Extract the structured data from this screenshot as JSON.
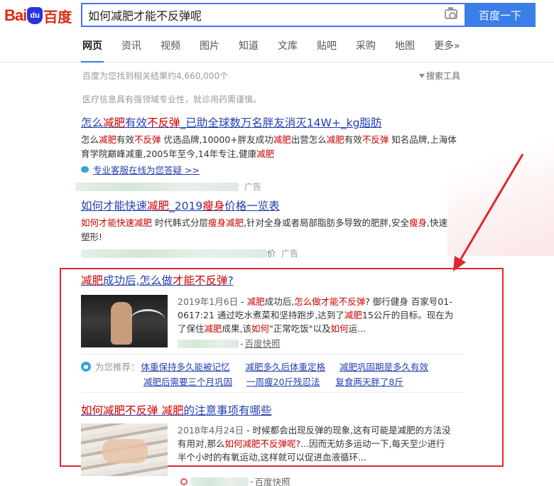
{
  "logo": {
    "en": "Bai",
    "paw": "du",
    "cn": "百度"
  },
  "search": {
    "query": "如何减肥才能不反弹呢",
    "button": "百度一下"
  },
  "nav": [
    "网页",
    "资讯",
    "视频",
    "图片",
    "知道",
    "文库",
    "贴吧",
    "采购",
    "地图",
    "更多»"
  ],
  "results": {
    "count_text": "百度为您找到相关结果约4,660,000个",
    "tools_label": "搜索工具",
    "medical_notice": "医疗信息具有强领域专业性，就诊用药需谨慎。"
  },
  "ad1": {
    "title": [
      "怎么",
      "减肥",
      "有效",
      "不反弹",
      "_已助全球数万名胖友消灭14W+_kg脂肪"
    ],
    "snippet_line1": [
      "怎么",
      "减肥",
      "有效",
      "不反弹",
      " 优选品牌,10000+胖友成功",
      "减肥",
      "出营怎么",
      "减肥",
      "有效",
      "不反弹",
      " 知名品牌,上海体"
    ],
    "snippet_line2": [
      "育学院巅峰减重,2005年至今,14年专注,健康",
      "减肥"
    ],
    "service_link": "专业客服在线为您答疑 >>",
    "ad_tag": "广告"
  },
  "ad2": {
    "title": [
      "如何才能快速",
      "减肥",
      "_2019",
      "瘦身",
      "价格一览表"
    ],
    "snippet_line1": [
      "如何才能",
      "快速减肥",
      " 时代韩式分层",
      "瘦身",
      "减肥",
      ",针对全身或者局部脂肪多导致的肥胖,安全",
      "瘦身",
      ",快速"
    ],
    "snippet_line2": "塑形!",
    "source_suffix": "价",
    "ad_tag": "广告"
  },
  "result1": {
    "title": [
      "减肥",
      "成功后,怎么做",
      "才能不反弹",
      "?"
    ],
    "date": "2019年1月6日",
    "line1": [
      " - ",
      "减肥",
      "成功后,",
      "怎么做才能不反弹",
      "? 御行健身 百家号01-"
    ],
    "line2": [
      "0617:21 通过吃水煮菜和坚持跑步,达到了",
      "减肥",
      "15公斤的目标。现在为"
    ],
    "line3": [
      "了保住",
      "减肥",
      "成果,该",
      "如何",
      "\"正常吃饭\"以及",
      "如何",
      "运..."
    ],
    "kuaizhao": "百度快照"
  },
  "recommend": {
    "label": "为您推荐：",
    "links": [
      "体重保持多久能被记忆",
      "减肥多久后体重定格",
      "减肥巩固期是多久有效",
      "减肥后需要三个月巩固",
      "一周瘦20斤残忍法",
      "复食两天胖了8斤"
    ]
  },
  "result2": {
    "title": [
      "如何",
      "减肥",
      "不反弹",
      " ",
      "减肥",
      "的注意事项有哪些"
    ],
    "date": "2018年4月24日",
    "line1": " - 时候都会出现反弹的现象,这有可能是减肥的方法没",
    "line2": [
      "有用对,那么",
      "如何减肥不反弹呢",
      "?...因而无妨多运动一下,每天至少进行"
    ],
    "line3": "半个小时的有氧运动,这样就可以促进血液循环...",
    "kuaizhao": "百度快照"
  },
  "colors": {
    "link": "#2440b3",
    "keyword": "#cc0000",
    "highlight_box": "#e0272d",
    "search_button": "#3b7ee8"
  }
}
